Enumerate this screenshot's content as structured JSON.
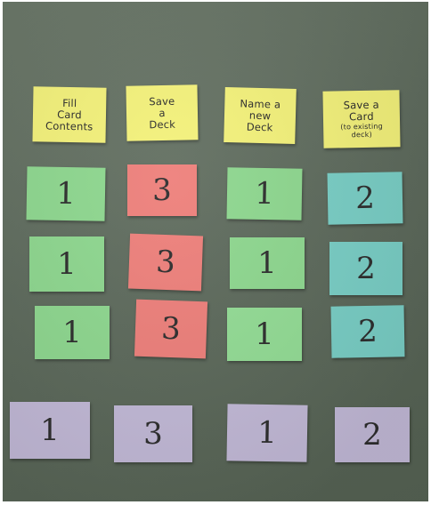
{
  "headers": [
    {
      "text": "Fill\nCard\nContents"
    },
    {
      "text": "Save\na\nDeck"
    },
    {
      "text": "Name a\nnew\nDeck"
    },
    {
      "text": "Save a\nCard",
      "small": "(to existing\ndeck)"
    }
  ],
  "rows": [
    {
      "values": [
        "1",
        "3",
        "1",
        "2"
      ]
    },
    {
      "values": [
        "1",
        "3",
        "1",
        "2"
      ]
    },
    {
      "values": [
        "1",
        "3",
        "1",
        "2"
      ]
    },
    {
      "values": [
        "1",
        "3",
        "1",
        "2"
      ]
    }
  ],
  "colors": {
    "board": "#5f6c5e",
    "sticky_yellow": "#f4f27a",
    "green": "#8ed88f",
    "red": "#ee7f7a",
    "teal": "#79cfc6",
    "purple": "#c3bad8"
  }
}
